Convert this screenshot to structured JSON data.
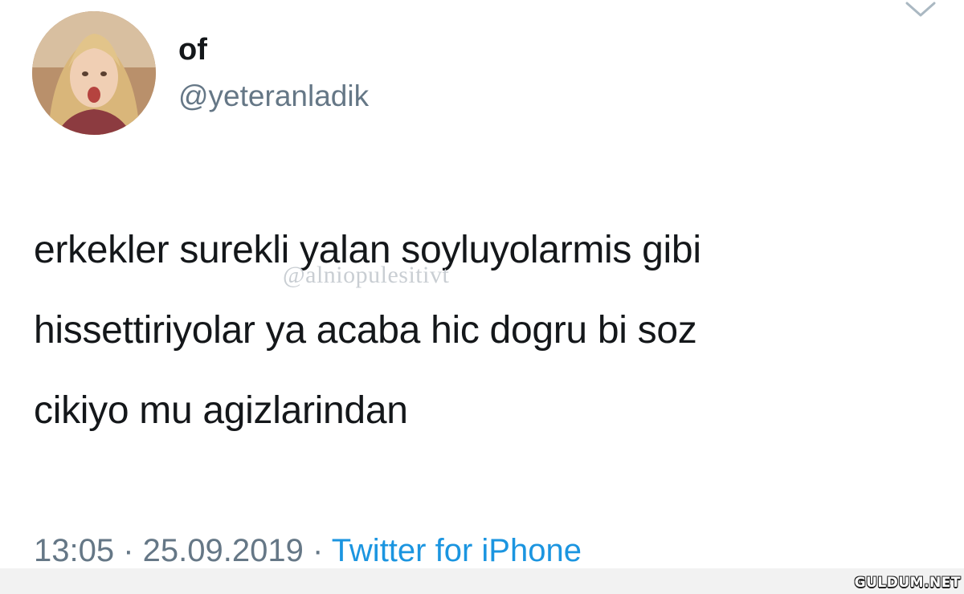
{
  "user": {
    "display_name": "of",
    "handle": "@yeteranladik",
    "avatar_icon": "profile-photo"
  },
  "tweet": {
    "lines": [
      "erkekler surekli yalan soyluyolarmis gibi",
      "hissettiriyolar ya acaba hic dogru bi soz",
      "cikiyo mu agizlarindan"
    ],
    "time": "13:05",
    "separator": " · ",
    "date": "25.09.2019",
    "source": "Twitter for iPhone"
  },
  "watermark": "@alniopulesitivt",
  "site_logo": "GULDUM.NET",
  "colors": {
    "text": "#14171a",
    "secondary": "#657786",
    "link": "#1b95e0"
  },
  "icons": {
    "menu": "chevron-down-icon"
  }
}
